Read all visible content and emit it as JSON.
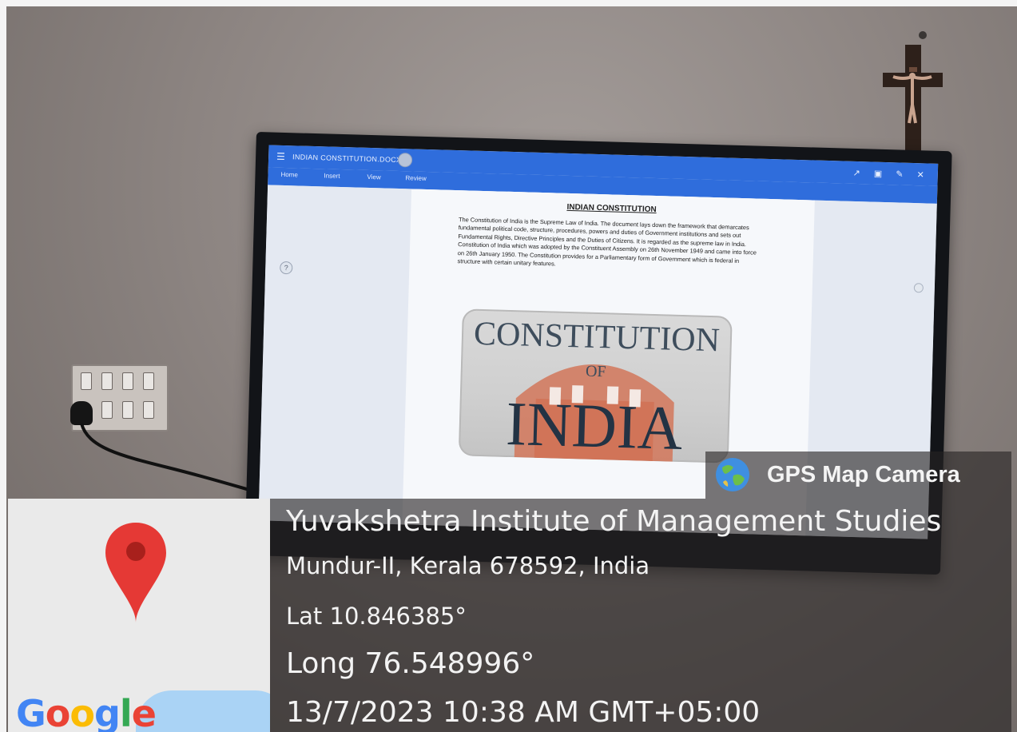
{
  "screen": {
    "app_title": "INDIAN CONSTITUTION.DOCX",
    "menu": [
      "Home",
      "Insert",
      "View",
      "Review"
    ],
    "window_controls": "↗ ▣ ✎ ✕",
    "help_symbol": "?",
    "document": {
      "heading": "INDIAN CONSTITUTION",
      "paragraph": "The Constitution of India is the Supreme Law of India. The document lays down the framework that demarcates fundamental political code, structure, procedures, powers and duties of Government institutions and sets out Fundamental Rights, Directive Principles and the Duties of Citizens. It is regarded as the supreme law in India. Constitution of India which was adopted by the Constituent Assembly on 26th November 1949 and came into force on 26th January 1950. The Constitution provides for a Parliamentary form of Government which is federal in structure with certain unitary features.",
      "image_text": {
        "line1": "CONSTITUTION",
        "line2": "OF",
        "line3": "INDIA"
      }
    }
  },
  "gps_stamp": {
    "badge_label": "GPS Map Camera",
    "place_name": "Yuvakshetra Institute of Management Studies",
    "address": "Mundur-II, Kerala 678592, India",
    "latitude": "Lat 10.846385°",
    "longitude": "Long 76.548996°",
    "timestamp": "13/7/2023 10:38 AM GMT+05:00",
    "map_logo": "Google"
  },
  "icons": {
    "map_pin": "map-pin-icon",
    "globe": "globe-icon",
    "menu": "hamburger-icon"
  },
  "colors": {
    "app_bar": "#2f6ddc",
    "pin": "#e53935",
    "overlay": "#262423"
  }
}
